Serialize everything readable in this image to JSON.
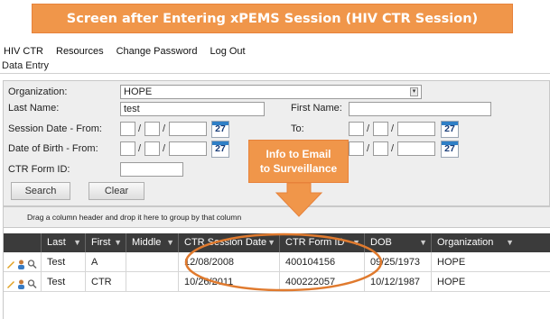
{
  "banner": {
    "title": "Screen after Entering xPEMS Session (HIV CTR Session)"
  },
  "menu": {
    "items": [
      "HIV CTR",
      "Resources",
      "Change Password",
      "Log Out"
    ]
  },
  "subtitle": "Data Entry",
  "form": {
    "organization_label": "Organization:",
    "organization_value": "HOPE",
    "last_name_label": "Last Name:",
    "last_name_value": "test",
    "first_name_label": "First Name:",
    "first_name_value": "",
    "session_date_label": "Session Date - From:",
    "to_label": "To:",
    "dob_label": "Date of Birth - From:",
    "ctr_form_id_label": "CTR Form ID:",
    "calendar_day": "27",
    "search_label": "Search",
    "clear_label": "Clear"
  },
  "callout": {
    "line1": "Info to Email",
    "line2": "to Surveillance"
  },
  "grid": {
    "group_hint": "Drag a column header and drop it here to group by that column",
    "columns": [
      "Last",
      "First",
      "Middle",
      "CTR Session Date",
      "CTR Form ID",
      "DOB",
      "Organization"
    ],
    "rows": [
      {
        "last": "Test",
        "first": "A",
        "middle": "",
        "session_date": "12/08/2008",
        "form_id": "400104156",
        "dob": "09/25/1973",
        "org": "HOPE"
      },
      {
        "last": "Test",
        "first": "CTR",
        "middle": "",
        "session_date": "10/26/2011",
        "form_id": "400222057",
        "dob": "10/12/1987",
        "org": "HOPE"
      }
    ]
  },
  "colors": {
    "accent": "#f0964a",
    "header": "#3b3b3b",
    "panel": "#eeeeee"
  }
}
